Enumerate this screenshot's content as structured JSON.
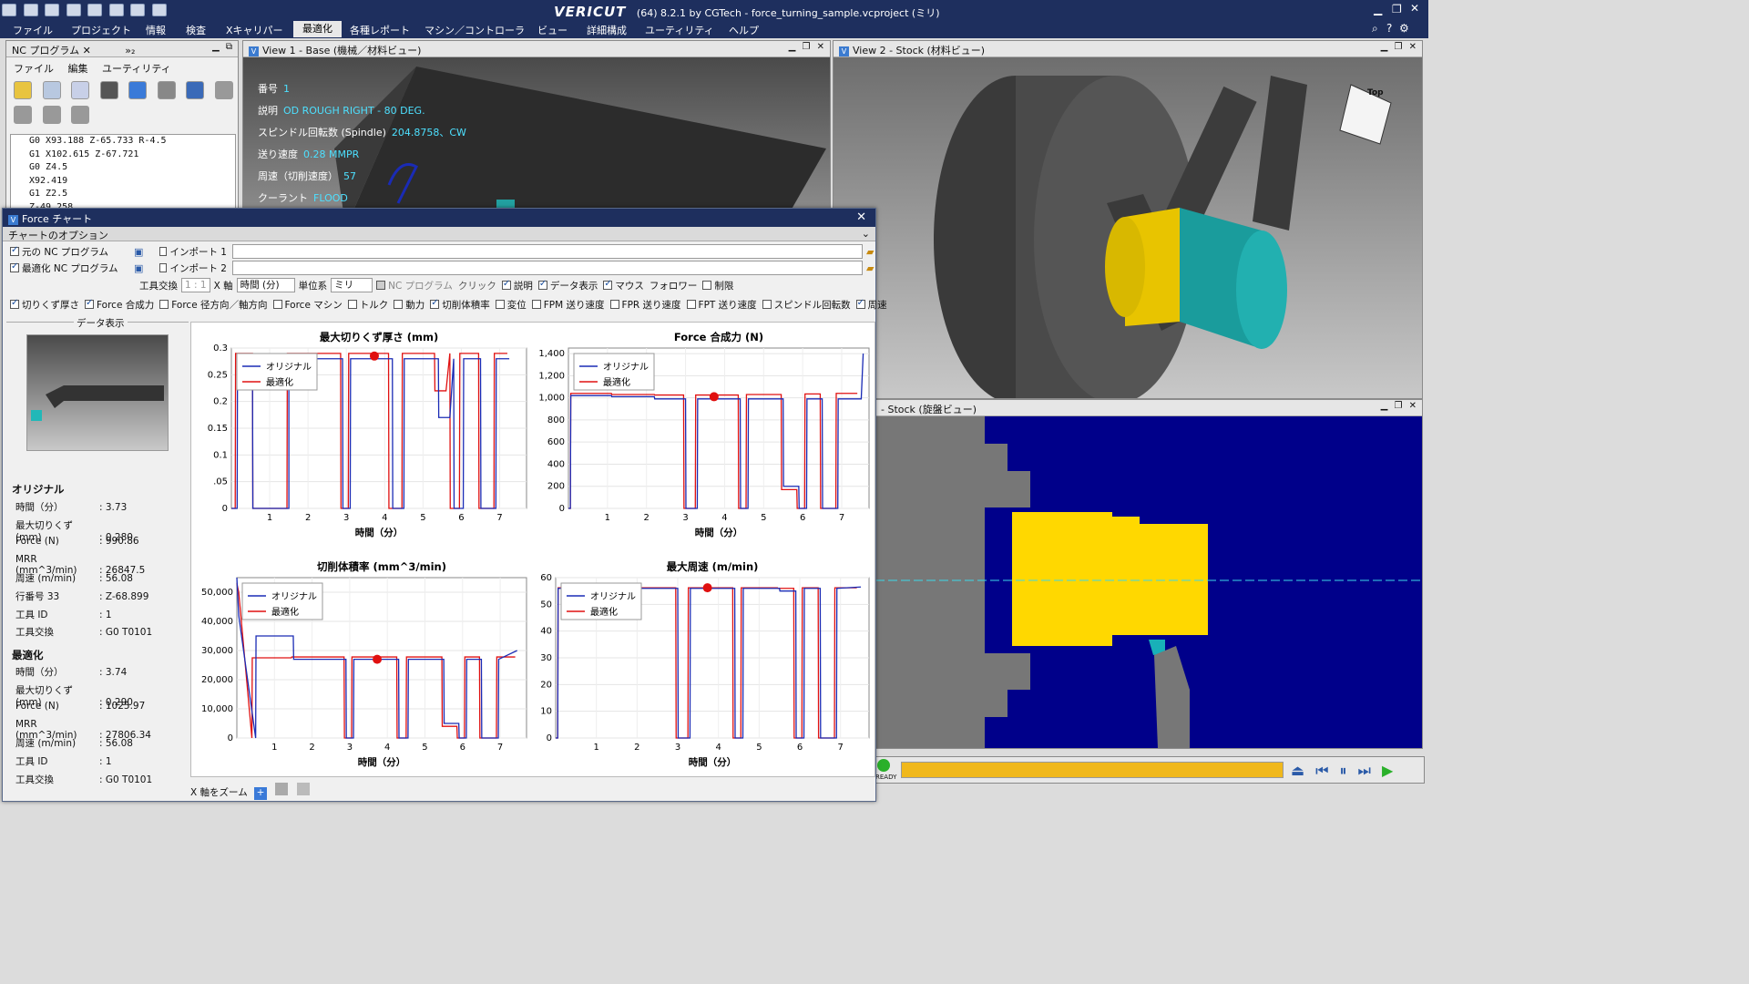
{
  "app": {
    "title": "(64)  8.2.1 by CGTech - force_turning_sample.vcproject (ミリ)",
    "logo": "VERICUT"
  },
  "menu": [
    "ファイル",
    "プロジェクト",
    "情報",
    "検査",
    "Xキャリパー",
    "最適化",
    "各種レポート",
    "マシン／コントローラ",
    "ビュー",
    "詳細構成",
    "ユーティリティ",
    "ヘルプ"
  ],
  "menu_active": "最適化",
  "nc_panel": {
    "tab": "NC プログラム",
    "tab_extra": "»₂",
    "menu": [
      "ファイル",
      "編集",
      "ユーティリティ"
    ],
    "code": [
      "G0 X93.188 Z-65.733 R-4.5",
      "G1 X102.615 Z-67.721",
      "G0 Z4.5",
      "X92.419",
      "G1 Z2.5",
      "Z-49.258"
    ]
  },
  "view1": {
    "title": "View 1 - Base (機械／材料ビュー)",
    "info": [
      {
        "k": "番号",
        "v": "1"
      },
      {
        "k": "説明",
        "v": "OD ROUGH RIGHT - 80 DEG."
      },
      {
        "k": "スピンドル回転数 (Spindle)",
        "v": "204.8758、CW"
      },
      {
        "k": "送り速度",
        "v": "0.28 MMPR"
      },
      {
        "k": "周速（切削速度）",
        "v": "57"
      },
      {
        "k": "クーラント",
        "v": "FLOOD"
      }
    ]
  },
  "view2": {
    "title": "View 2 - Stock (材料ビュー)",
    "cube_label": "Top"
  },
  "stock_view": {
    "title": "- Stock (旋盤ビュー)"
  },
  "playbar": {
    "status": "READY"
  },
  "force": {
    "title": "Force チャート",
    "options_header": "チャートのオプション",
    "row1": {
      "a": "元の NC プログラム",
      "b": "インポート 1"
    },
    "row2": {
      "a": "最適化 NC プログラム",
      "b": "インポート 2"
    },
    "row3": {
      "tool_change": "工具交換",
      "tool_val": "1 : 1",
      "x_axis": "X 軸",
      "x_val": "時間 (分)",
      "units": "単位系",
      "units_val": "ミリ",
      "nc_prog": "NC プログラム",
      "click": "クリック",
      "desc": "説明",
      "data_disp": "データ表示",
      "mouse": "マウス",
      "follow": "フォロワー",
      "limit": "制限"
    },
    "row4": [
      {
        "label": "切りくず厚さ",
        "on": true
      },
      {
        "label": "Force 合成力",
        "on": true
      },
      {
        "label": "Force 径方向／軸方向",
        "on": false
      },
      {
        "label": "Force マシン",
        "on": false
      },
      {
        "label": "トルク",
        "on": false
      },
      {
        "label": "動力",
        "on": false
      },
      {
        "label": "切削体積率",
        "on": true
      },
      {
        "label": "変位",
        "on": false
      },
      {
        "label": "FPM 送り速度",
        "on": false
      },
      {
        "label": "FPR 送り速度",
        "on": false
      },
      {
        "label": "FPT 送り速度",
        "on": false
      },
      {
        "label": "スピンドル回転数",
        "on": false
      },
      {
        "label": "周速",
        "on": true
      }
    ],
    "data_display": {
      "title": "データ表示",
      "original_head": "オリジナル",
      "original": [
        {
          "k": "時間（分）",
          "v": ": 3.73"
        },
        {
          "k": "最大切りくず (mm)",
          "v": ": 0.280"
        },
        {
          "k": "Force (N)",
          "v": ": 990.86"
        },
        {
          "k": "MRR (mm^3/min)",
          "v": ": 26847.5"
        },
        {
          "k": "周速 (m/min)",
          "v": ": 56.08"
        },
        {
          "k": "行番号 33",
          "v": ": Z-68.899"
        },
        {
          "k": "工具 ID",
          "v": ": 1"
        },
        {
          "k": "工具交換",
          "v": ": G0 T0101"
        }
      ],
      "optimized_head": "最適化",
      "optimized": [
        {
          "k": "時間（分）",
          "v": ": 3.74"
        },
        {
          "k": "最大切りくず (mm)",
          "v": ": 0.290"
        },
        {
          "k": "Force (N)",
          "v": ": 1025.97"
        },
        {
          "k": "MRR (mm^3/min)",
          "v": ": 27806.34"
        },
        {
          "k": "周速 (m/min)",
          "v": ": 56.08"
        },
        {
          "k": "工具 ID",
          "v": ": 1"
        },
        {
          "k": "工具交換",
          "v": ": G0 T0101"
        }
      ]
    },
    "zoom_label": "X 軸をズーム"
  },
  "colors": {
    "original": "#1a2bb5",
    "optimized": "#e01010",
    "marker": "#e01010"
  },
  "chart_data": [
    {
      "type": "line",
      "title": "最大切りくず厚さ (mm)",
      "xlabel": "時間（分）",
      "ylabel": "",
      "xlim": [
        0,
        7.7
      ],
      "ylim": [
        0,
        0.3
      ],
      "yticks": [
        0,
        0.05,
        0.1,
        0.15,
        0.2,
        0.25,
        0.3
      ],
      "ytick_labels": [
        "0",
        ".05",
        "0.1",
        "0.15",
        "0.2",
        "0.25",
        "0.3"
      ],
      "xticks": [
        1,
        2,
        3,
        4,
        5,
        6,
        7
      ],
      "marker": {
        "x": 3.73,
        "y": 0.285
      },
      "series": [
        {
          "name": "オリジナル",
          "x": [
            0,
            0.15,
            0.16,
            0.55,
            0.56,
            1.5,
            1.5,
            2.9,
            2.91,
            3.1,
            3.11,
            4.2,
            4.21,
            4.5,
            4.51,
            5.4,
            5.41,
            5.7,
            5.8,
            5.81,
            6.05,
            6.06,
            6.5,
            6.51,
            6.9,
            6.91,
            7.25
          ],
          "y": [
            0,
            0,
            0.28,
            0.28,
            0,
            0,
            0.28,
            0.28,
            0,
            0,
            0.28,
            0.28,
            0,
            0,
            0.28,
            0.28,
            0.17,
            0.17,
            0.28,
            0,
            0,
            0.28,
            0.28,
            0,
            0,
            0.28,
            0.28
          ]
        },
        {
          "name": "最適化",
          "x": [
            0,
            0.1,
            0.11,
            0.55,
            0.56,
            1.45,
            1.46,
            2.85,
            2.86,
            3.05,
            3.06,
            4.1,
            4.11,
            4.45,
            4.46,
            5.3,
            5.31,
            5.6,
            5.7,
            5.71,
            5.95,
            5.96,
            6.45,
            6.46,
            6.85,
            6.86,
            7.2
          ],
          "y": [
            0,
            0,
            0.29,
            0.29,
            0,
            0,
            0.29,
            0.29,
            0,
            0,
            0.29,
            0.29,
            0,
            0,
            0.29,
            0.29,
            0.22,
            0.22,
            0.29,
            0,
            0,
            0.29,
            0.29,
            0,
            0,
            0.29,
            0.29
          ]
        }
      ]
    },
    {
      "type": "line",
      "title": "Force 合成力 (N)",
      "xlabel": "時間（分）",
      "ylabel": "",
      "xlim": [
        0,
        7.7
      ],
      "ylim": [
        0,
        1450
      ],
      "yticks": [
        0,
        200,
        400,
        600,
        800,
        1000,
        1200,
        1400
      ],
      "ytick_labels": [
        "0",
        "200",
        "400",
        "600",
        "800",
        "1,000",
        "1,200",
        "1,400"
      ],
      "xticks": [
        1,
        2,
        3,
        4,
        5,
        6,
        7
      ],
      "marker": {
        "x": 3.73,
        "y": 1010
      },
      "series": [
        {
          "name": "オリジナル",
          "x": [
            0,
            0.05,
            0.06,
            1.1,
            1.11,
            2.2,
            2.21,
            3.0,
            3.01,
            3.3,
            3.31,
            4.4,
            4.41,
            4.6,
            4.61,
            5.5,
            5.51,
            5.9,
            5.91,
            6.1,
            6.11,
            6.5,
            6.51,
            6.9,
            6.91,
            7.5,
            7.55
          ],
          "y": [
            0,
            0,
            1020,
            1020,
            1010,
            1010,
            990,
            990,
            0,
            0,
            990,
            990,
            0,
            0,
            990,
            990,
            200,
            200,
            0,
            0,
            990,
            990,
            0,
            0,
            990,
            990,
            1400
          ]
        },
        {
          "name": "最適化",
          "x": [
            0,
            0.05,
            0.06,
            1.1,
            1.11,
            2.2,
            2.21,
            2.95,
            2.96,
            3.25,
            3.26,
            4.35,
            4.36,
            4.55,
            4.56,
            5.45,
            5.46,
            5.85,
            5.86,
            6.05,
            6.06,
            6.45,
            6.46,
            6.85,
            6.86,
            7.4
          ],
          "y": [
            0,
            0,
            1040,
            1040,
            1030,
            1030,
            1025,
            1025,
            0,
            0,
            1025,
            1025,
            0,
            0,
            1030,
            1030,
            170,
            170,
            0,
            0,
            1035,
            1035,
            0,
            0,
            1040,
            1040
          ]
        }
      ]
    },
    {
      "type": "line",
      "title": "切削体積率 (mm^3/min)",
      "xlabel": "時間（分）",
      "ylabel": "",
      "xlim": [
        0,
        7.7
      ],
      "ylim": [
        0,
        55000
      ],
      "yticks": [
        0,
        10000,
        20000,
        30000,
        40000,
        50000
      ],
      "ytick_labels": [
        "0",
        "10,000",
        "20,000",
        "30,000",
        "40,000",
        "50,000"
      ],
      "xticks": [
        1,
        2,
        3,
        4,
        5,
        6,
        7
      ],
      "marker": {
        "x": 3.73,
        "y": 27000
      },
      "series": [
        {
          "name": "オリジナル",
          "x": [
            0,
            0.05,
            0.5,
            0.51,
            1.5,
            1.51,
            2.9,
            2.91,
            3.1,
            3.11,
            4.3,
            4.31,
            4.55,
            4.56,
            5.5,
            5.51,
            5.9,
            5.91,
            6.1,
            6.11,
            6.5,
            6.51,
            6.95,
            6.96,
            7.45
          ],
          "y": [
            55000,
            42000,
            0,
            35000,
            35000,
            27000,
            27000,
            0,
            0,
            27000,
            27000,
            0,
            0,
            27000,
            27000,
            5000,
            5000,
            0,
            0,
            27000,
            27000,
            0,
            0,
            27000,
            30000
          ]
        },
        {
          "name": "最適化",
          "x": [
            0,
            0.05,
            0.4,
            0.41,
            1.45,
            1.46,
            2.85,
            2.86,
            3.05,
            3.06,
            4.25,
            4.26,
            4.5,
            4.51,
            5.45,
            5.46,
            5.85,
            5.86,
            6.05,
            6.06,
            6.45,
            6.46,
            6.9,
            6.91,
            7.4
          ],
          "y": [
            53000,
            50000,
            0,
            27500,
            27500,
            27800,
            27800,
            0,
            0,
            27800,
            27800,
            0,
            0,
            27800,
            27800,
            4000,
            4000,
            0,
            0,
            27800,
            27800,
            0,
            0,
            27800,
            27800
          ]
        }
      ]
    },
    {
      "type": "line",
      "title": "最大周速 (m/min)",
      "xlabel": "時間（分）",
      "ylabel": "",
      "xlim": [
        0,
        7.7
      ],
      "ylim": [
        0,
        60
      ],
      "yticks": [
        0,
        10,
        20,
        30,
        40,
        50,
        60
      ],
      "ytick_labels": [
        "0",
        "10",
        "20",
        "30",
        "40",
        "50",
        "60"
      ],
      "xticks": [
        1,
        2,
        3,
        4,
        5,
        6,
        7
      ],
      "marker": {
        "x": 3.73,
        "y": 56.2
      },
      "series": [
        {
          "name": "オリジナル",
          "x": [
            0,
            0.05,
            0.06,
            3.0,
            3.01,
            3.3,
            3.31,
            4.4,
            4.41,
            4.6,
            4.61,
            5.5,
            5.51,
            5.9,
            5.91,
            6.1,
            6.11,
            6.5,
            6.51,
            6.9,
            6.91,
            7.5
          ],
          "y": [
            0,
            0,
            56,
            56,
            0,
            0,
            56,
            56,
            0,
            0,
            56,
            56,
            55,
            55,
            0,
            0,
            56,
            56,
            0,
            0,
            56,
            56.5
          ]
        },
        {
          "name": "最適化",
          "x": [
            0,
            0.05,
            0.06,
            2.95,
            2.96,
            3.25,
            3.26,
            4.35,
            4.36,
            4.55,
            4.56,
            5.45,
            5.46,
            5.85,
            5.86,
            6.05,
            6.06,
            6.45,
            6.46,
            6.85,
            6.86,
            7.4
          ],
          "y": [
            0,
            0,
            56.2,
            56.2,
            0,
            0,
            56.2,
            56.2,
            0,
            0,
            56.2,
            56.2,
            56,
            56,
            0,
            0,
            56.2,
            56.2,
            0,
            0,
            56.2,
            56.2
          ]
        }
      ]
    }
  ]
}
